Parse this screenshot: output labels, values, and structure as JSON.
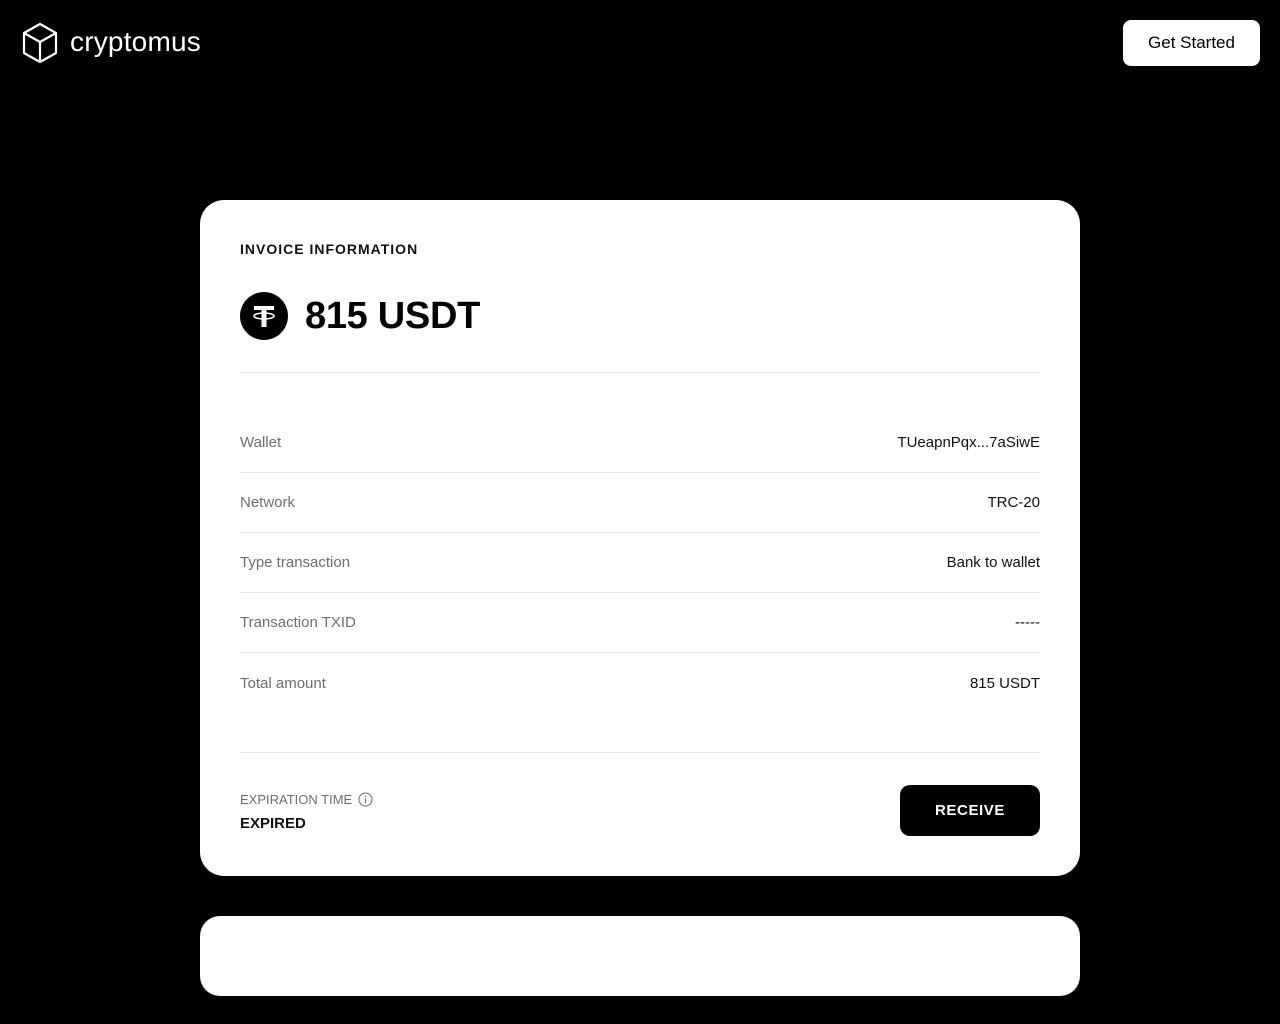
{
  "header": {
    "logo_text": "cryptomus",
    "logo_icon": "cube-icon",
    "cta_label": "Get Started"
  },
  "invoice": {
    "title": "INVOICE INFORMATION",
    "amount": "815 USDT",
    "currency_icon": "tether-icon",
    "rows": [
      {
        "label": "Wallet",
        "value": "TUeapnPqx...7aSiwE"
      },
      {
        "label": "Network",
        "value": "TRC-20"
      },
      {
        "label": "Type transaction",
        "value": "Bank to wallet"
      },
      {
        "label": "Transaction TXID",
        "value": "-----"
      },
      {
        "label": "Total amount",
        "value": "815 USDT"
      }
    ],
    "expiration_label": "EXPIRATION TIME",
    "expiration_value": "EXPIRED",
    "receive_label": "RECEIVE"
  },
  "colors": {
    "background": "#000000",
    "card": "#ffffff",
    "accent": "#000000"
  }
}
